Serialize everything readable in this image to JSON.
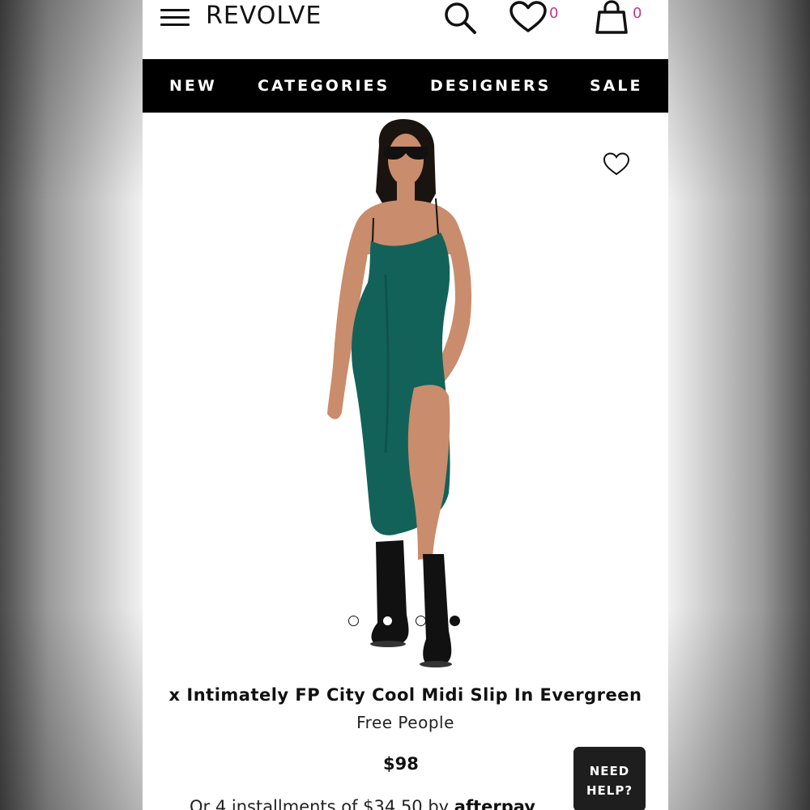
{
  "header": {
    "logo": "REVOLVE",
    "wishlist_count": "0",
    "bag_count": "0"
  },
  "nav": {
    "items": [
      "NEW",
      "CATEGORIES",
      "DESIGNERS",
      "SALE"
    ]
  },
  "product": {
    "title": "x Intimately FP City Cool Midi Slip In Evergreen",
    "brand": "Free People",
    "price": "$98",
    "installments_text": "Or 4 installments of $34.50 by",
    "installments_provider": "afterpay",
    "image_count": 4,
    "active_image": 4,
    "colors": {
      "dress": "#13625a",
      "skin": "#c98c6c",
      "boots": "#111111"
    }
  },
  "help_button": {
    "line1": "NEED",
    "line2": "HELP?"
  },
  "colors": {
    "accent": "#c2378e",
    "nav_bg": "#000000"
  }
}
